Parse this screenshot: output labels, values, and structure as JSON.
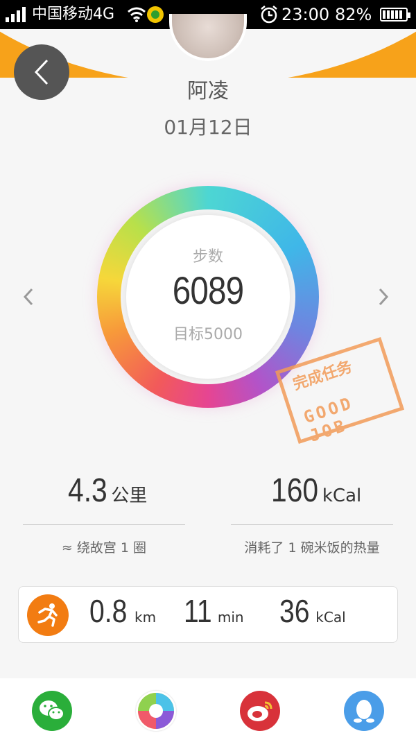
{
  "status_bar": {
    "carrier": "中国移动4G",
    "time": "23:00",
    "battery_percent": "82%"
  },
  "profile": {
    "name": "阿凌",
    "date": "01月12日"
  },
  "steps": {
    "label": "步数",
    "value": "6089",
    "goal": "目标5000"
  },
  "stamp": {
    "line1": "完成任务",
    "line2": "GOOD JOB"
  },
  "distance": {
    "value": "4.3",
    "unit": "公里",
    "description": "≈ 绕故宫 1 圈"
  },
  "calories": {
    "value": "160",
    "unit": "kCal",
    "description": "消耗了 1 碗米饭的热量"
  },
  "run_card": {
    "distance_value": "0.8",
    "distance_unit": "km",
    "time_value": "11",
    "time_unit": "min",
    "calories_value": "36",
    "calories_unit": "kCal"
  },
  "share_targets": [
    {
      "name": "wechat",
      "color": "#2aae3a"
    },
    {
      "name": "moments",
      "color": "#ffffff"
    },
    {
      "name": "weibo",
      "color": "#d8323a"
    },
    {
      "name": "qq",
      "color": "#4a9de8"
    }
  ],
  "colors": {
    "accent_orange": "#f7a21a",
    "run_icon": "#f27c12"
  }
}
